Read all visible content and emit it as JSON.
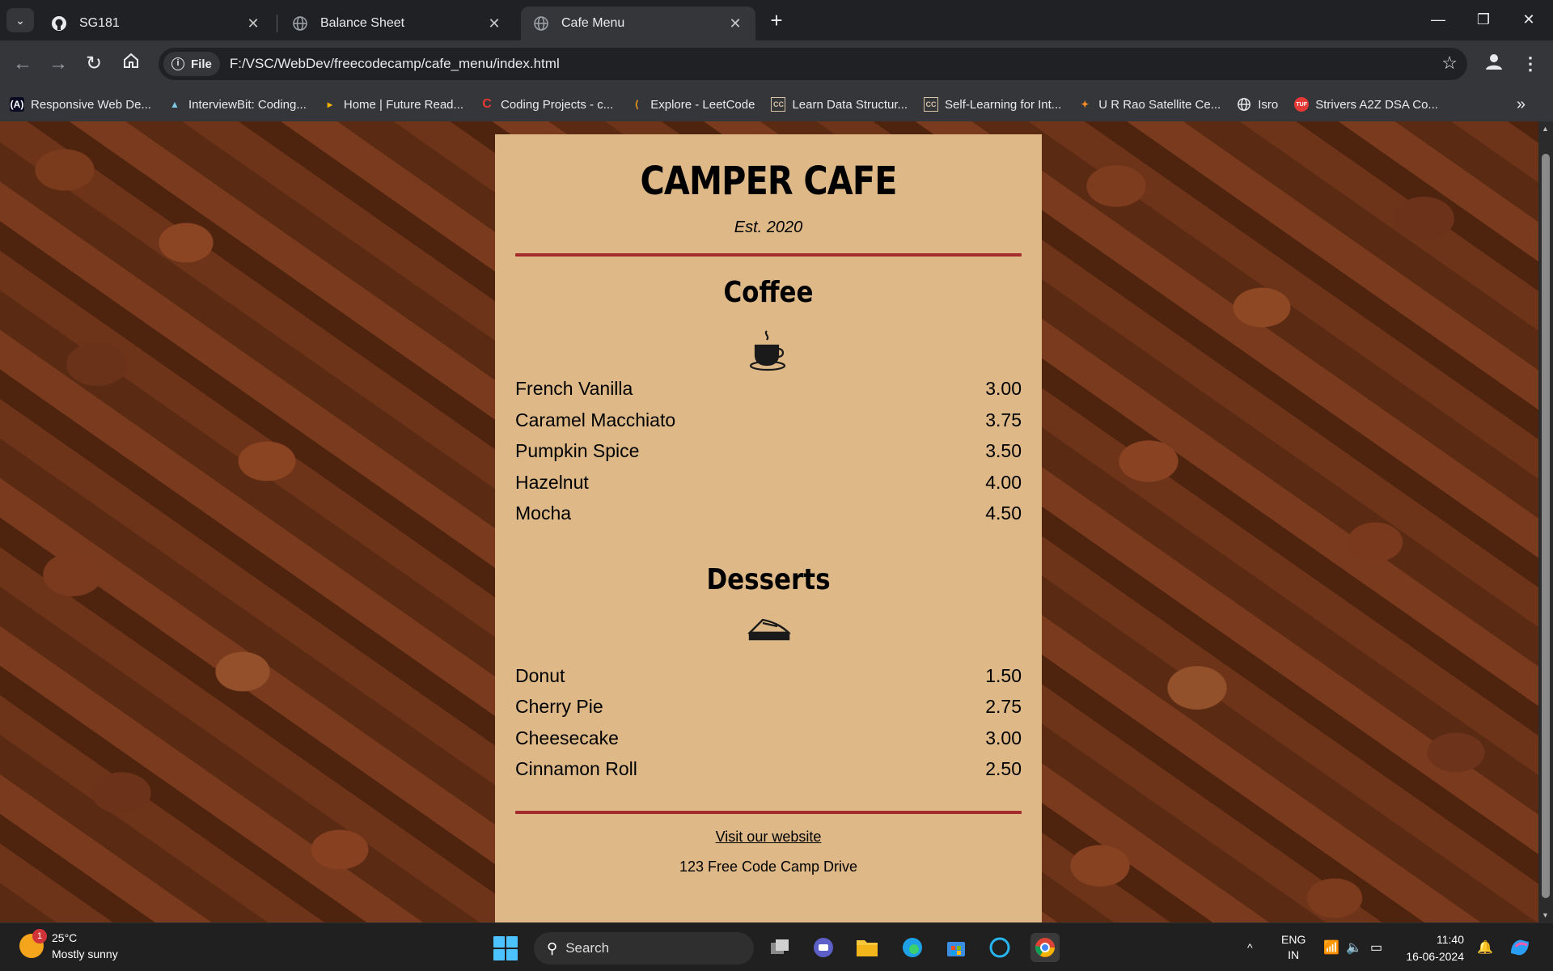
{
  "browser": {
    "tabs": [
      {
        "label": "SG181",
        "icon": "github-icon"
      },
      {
        "label": "Balance Sheet",
        "icon": "globe-icon"
      },
      {
        "label": "Cafe Menu",
        "icon": "globe-icon",
        "active": true
      }
    ],
    "address": {
      "chip": "File",
      "url": "F:/VSC/WebDev/freecodecamp/cafe_menu/index.html"
    },
    "bookmarks": [
      {
        "label": "Responsive Web De...",
        "icon": "freecodecamp-icon"
      },
      {
        "label": "InterviewBit: Coding...",
        "icon": "interviewbit-icon"
      },
      {
        "label": "Home | Future Read...",
        "icon": "play-icon"
      },
      {
        "label": "Coding Projects - c...",
        "icon": "c-logo-icon"
      },
      {
        "label": "Explore - LeetCode",
        "icon": "leetcode-icon"
      },
      {
        "label": "Learn Data Structur...",
        "icon": "cc-icon"
      },
      {
        "label": "Self-Learning for Int...",
        "icon": "cc-icon"
      },
      {
        "label": "U R Rao Satellite Ce...",
        "icon": "isro-icon"
      },
      {
        "label": "Isro",
        "icon": "globe-icon"
      },
      {
        "label": "Strivers A2Z DSA Co...",
        "icon": "tuf-icon"
      }
    ]
  },
  "menu": {
    "title": "CAMPER CAFE",
    "established": "Est. 2020",
    "coffee": {
      "heading": "Coffee",
      "items": [
        {
          "name": "French Vanilla",
          "price": "3.00"
        },
        {
          "name": "Caramel Macchiato",
          "price": "3.75"
        },
        {
          "name": "Pumpkin Spice",
          "price": "3.50"
        },
        {
          "name": "Hazelnut",
          "price": "4.00"
        },
        {
          "name": "Mocha",
          "price": "4.50"
        }
      ]
    },
    "desserts": {
      "heading": "Desserts",
      "items": [
        {
          "name": "Donut",
          "price": "1.50"
        },
        {
          "name": "Cherry Pie",
          "price": "2.75"
        },
        {
          "name": "Cheesecake",
          "price": "3.00"
        },
        {
          "name": "Cinnamon Roll",
          "price": "2.50"
        }
      ]
    },
    "footer": {
      "link": "Visit our website",
      "address": "123 Free Code Camp Drive"
    },
    "colors": {
      "card": "#deb887",
      "rule": "#a42c2c"
    }
  },
  "taskbar": {
    "weather": {
      "temp": "25°C",
      "condition": "Mostly sunny",
      "badge": "1"
    },
    "search_placeholder": "Search",
    "language": {
      "top": "ENG",
      "bottom": "IN"
    },
    "clock": {
      "time": "11:40",
      "date": "16-06-2024"
    }
  }
}
